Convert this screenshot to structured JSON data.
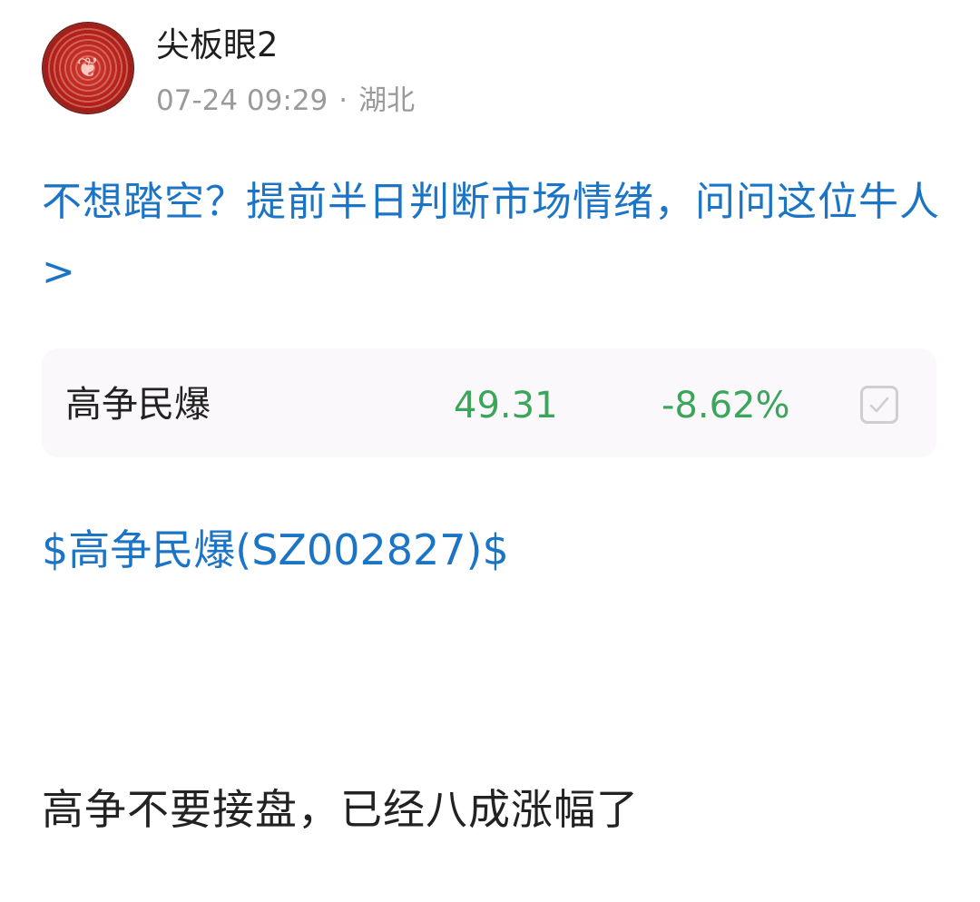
{
  "post": {
    "author": "尖板眼2",
    "time": "07-24 09:29",
    "separator": "·",
    "location": "湖北",
    "promo_text": "不想踏空？提前半日判断市场情绪，问问这位牛人>",
    "body": "高争不要接盘，已经八成涨幅了"
  },
  "stock": {
    "name": "高争民爆",
    "price": "49.31",
    "change": "-8.62%",
    "link": "$高争民爆(SZ002827)$",
    "watch_icon": "checkbox-check-icon"
  },
  "colors": {
    "link": "#1b74c5",
    "down": "#3aa659",
    "meta": "#9a9a9a",
    "card_bg": "#fbf8fb"
  }
}
